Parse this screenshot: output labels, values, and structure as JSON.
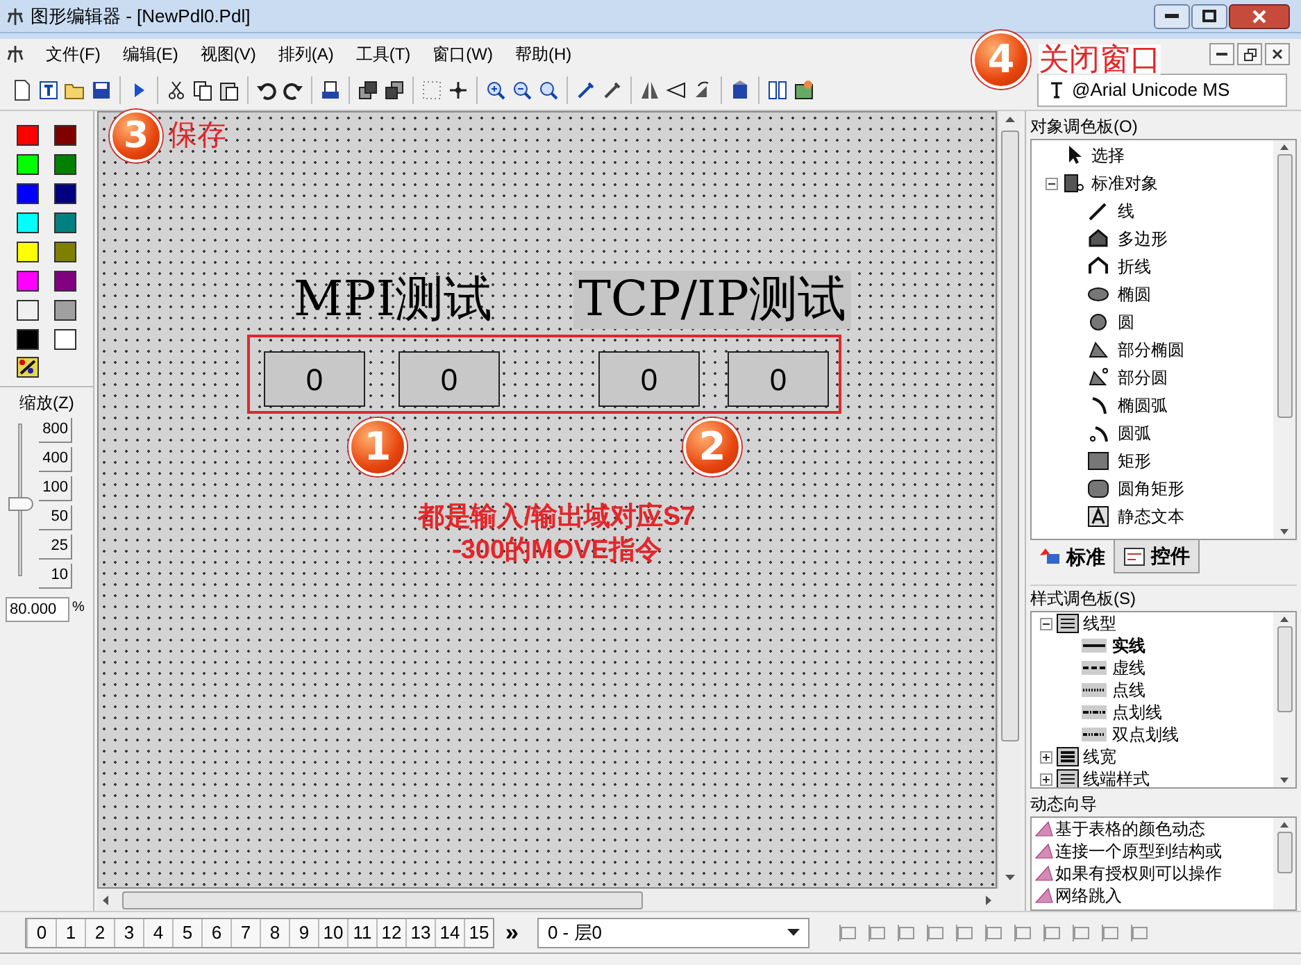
{
  "window": {
    "title": "图形编辑器 - [NewPdl0.Pdl]"
  },
  "menu": [
    "文件(F)",
    "编辑(E)",
    "视图(V)",
    "排列(A)",
    "工具(T)",
    "窗口(W)",
    "帮助(H)"
  ],
  "font_select": "@Arial Unicode MS",
  "color_palette": [
    {
      "color": "#ff0000"
    },
    {
      "color": "#800000"
    },
    {
      "color": "#00ff00"
    },
    {
      "color": "#008000"
    },
    {
      "color": "#0000ff"
    },
    {
      "color": "#000080"
    },
    {
      "color": "#00ffff"
    },
    {
      "color": "#008080"
    },
    {
      "color": "#ffff00"
    },
    {
      "color": "#808000"
    },
    {
      "color": "#ff00ff"
    },
    {
      "color": "#800080"
    },
    {
      "color": "#f0f0f0"
    },
    {
      "color": "#a0a0a0"
    },
    {
      "color": "#000000"
    },
    {
      "color": "#ffffff"
    }
  ],
  "zoom": {
    "label": "缩放(Z)",
    "presets": [
      "800",
      "400",
      "100",
      "50",
      "25",
      "10"
    ],
    "level": 0.47,
    "value": "80.000",
    "unit": "%"
  },
  "canvas": {
    "labels": [
      {
        "text": "MPI测试",
        "highlighted": false
      },
      {
        "text": "TCP/IP测试",
        "highlighted": true
      }
    ],
    "fields": [
      "0",
      "0",
      "0",
      "0"
    ]
  },
  "annotations": {
    "save": {
      "number": "3",
      "text": "保存"
    },
    "close": {
      "number": "4",
      "text": "关闭窗口"
    },
    "field_marks": [
      "1",
      "2"
    ],
    "note": "都是输入/输出域对应S7\n-300的MOVE指令"
  },
  "object_palette": {
    "title": "对象调色板(O)",
    "items": [
      {
        "label": "选择"
      },
      {
        "label": "标准对象",
        "expanded": true,
        "children": [
          {
            "label": "线"
          },
          {
            "label": "多边形"
          },
          {
            "label": "折线"
          },
          {
            "label": "椭圆"
          },
          {
            "label": "圆"
          },
          {
            "label": "部分椭圆"
          },
          {
            "label": "部分圆"
          },
          {
            "label": "椭圆弧"
          },
          {
            "label": "圆弧"
          },
          {
            "label": "矩形"
          },
          {
            "label": "圆角矩形"
          },
          {
            "label": "静态文本"
          }
        ]
      }
    ],
    "tabs": [
      {
        "label": "标准",
        "selected": true
      },
      {
        "label": "控件",
        "selected": false
      }
    ]
  },
  "style_palette": {
    "title": "样式调色板(S)",
    "items": [
      {
        "label": "线型",
        "expanded": true,
        "children": [
          {
            "label": "实线",
            "selected": true
          },
          {
            "label": "虚线",
            "selected": false
          },
          {
            "label": "点线",
            "selected": false
          },
          {
            "label": "点划线",
            "selected": false
          },
          {
            "label": "双点划线",
            "selected": false
          }
        ]
      },
      {
        "label": "线宽",
        "expanded": false
      },
      {
        "label": "线端样式",
        "expanded": false
      }
    ]
  },
  "dynamic_wizard": {
    "title": "动态向导",
    "items": [
      "基于表格的颜色动态",
      "连接一个原型到结构或",
      "如果有授权则可以操作",
      "网络跳入"
    ]
  },
  "layers": [
    "0",
    "1",
    "2",
    "3",
    "4",
    "5",
    "6",
    "7",
    "8",
    "9",
    "10",
    "11",
    "12",
    "13",
    "14",
    "15"
  ],
  "layer_more": "»",
  "layer_select": "0 - 层0"
}
